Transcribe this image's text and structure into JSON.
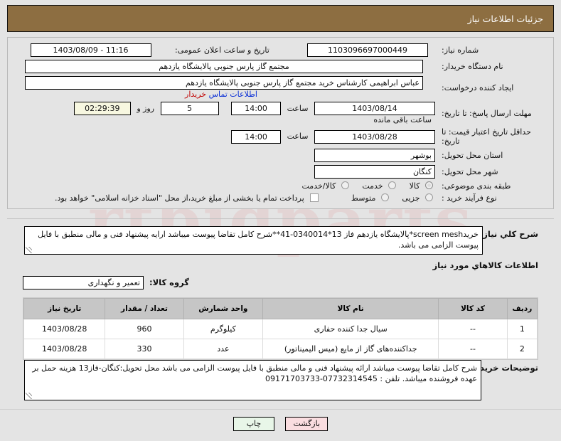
{
  "header": {
    "title": "جزئیات اطلاعات نیاز"
  },
  "watermark": {
    "line1": "rtbidparts",
    "line2": ""
  },
  "form": {
    "need_number": {
      "label": "شماره نیاز:",
      "value": "1103096697000449"
    },
    "announce": {
      "label": "تاریخ و ساعت اعلان عمومی:",
      "value": "11:16 - 1403/08/09"
    },
    "buyer_org": {
      "label": "نام دستگاه خریدار:",
      "value": "مجتمع گاز پارس جنوبی  پالایشگاه یازدهم"
    },
    "requester": {
      "label": "ایجاد کننده درخواست:",
      "value": "عباس ابراهیمی کارشناس خرید مجتمع گاز پارس جنوبی  پالایشگاه یازدهم"
    },
    "contact_link": {
      "label_blue": "اطلاعات تماس",
      "label_red": "خریدار"
    },
    "reply_deadline": {
      "label": "مهلت ارسال پاسخ: تا تاریخ:",
      "date": "1403/08/14",
      "time_label": "ساعت",
      "time": "14:00",
      "days": "5",
      "days_sep": "روز و",
      "countdown": "02:29:39",
      "remaining_label": "ساعت باقی مانده"
    },
    "price_validity": {
      "label": "حداقل تاریخ اعتبار قیمت: تا تاریخ:",
      "date": "1403/08/28",
      "time_label": "ساعت",
      "time": "14:00"
    },
    "province": {
      "label": "استان محل تحویل:",
      "value": "بوشهر"
    },
    "city": {
      "label": "شهر محل تحویل:",
      "value": "کنگان"
    },
    "subject_class": {
      "label": "طبقه بندی موضوعی:",
      "options": [
        {
          "text": "کالا",
          "selected": true
        },
        {
          "text": "خدمت",
          "selected": false
        },
        {
          "text": "کالا/خدمت",
          "selected": false
        }
      ]
    },
    "purchase_type": {
      "label": "نوع فرآیند خرید :",
      "options": [
        {
          "text": "جزیی",
          "selected": false
        },
        {
          "text": "متوسط",
          "selected": false
        }
      ],
      "checkbox_text": "پرداخت تمام یا بخشی از مبلغ خرید،از محل \"اسناد خزانه اسلامی\" خواهد بود."
    }
  },
  "need_description": {
    "label": "شرح کلي نياز:",
    "value": "خریدscreen mesh*پالایشگاه یازدهم فاز 13*0340014-41**شرح کامل تقاضا پیوست میباشد ارایه پیشنهاد فنی و مالی منطبق با فایل پیوست الزامی می باشد."
  },
  "goods_section": {
    "title": "اطلاعات كالاهاي مورد نياز",
    "group_label": "گروه كالا:",
    "group_value": "تعمیر و نگهداری",
    "columns": [
      "ردیف",
      "کد کالا",
      "نام کالا",
      "واحد شمارش",
      "تعداد / مقدار",
      "تاریخ نیاز"
    ],
    "rows": [
      {
        "index": "1",
        "code": "--",
        "name": "سیال جدا کننده حفاری",
        "unit": "کیلوگرم",
        "qty": "960",
        "date": "1403/08/28"
      },
      {
        "index": "2",
        "code": "--",
        "name": "جداکننده‌های گاز از مایع (میس الیمیناتور)",
        "unit": "عدد",
        "qty": "330",
        "date": "1403/08/28"
      }
    ]
  },
  "buyer_notes": {
    "label": "توضیحات خریدار:",
    "value": "شرح کامل تقاضا پیوست میباشد ارائه پیشنهاد فنی و مالی منطبق با فایل پیوست الزامی می باشد محل تحویل:کنگان-فاز13 هزینه حمل بر عهده فروشنده میباشد. تلفن : 07732314545-09171703733"
  },
  "footer": {
    "print_label": "چاپ",
    "back_label": "بازگشت"
  }
}
